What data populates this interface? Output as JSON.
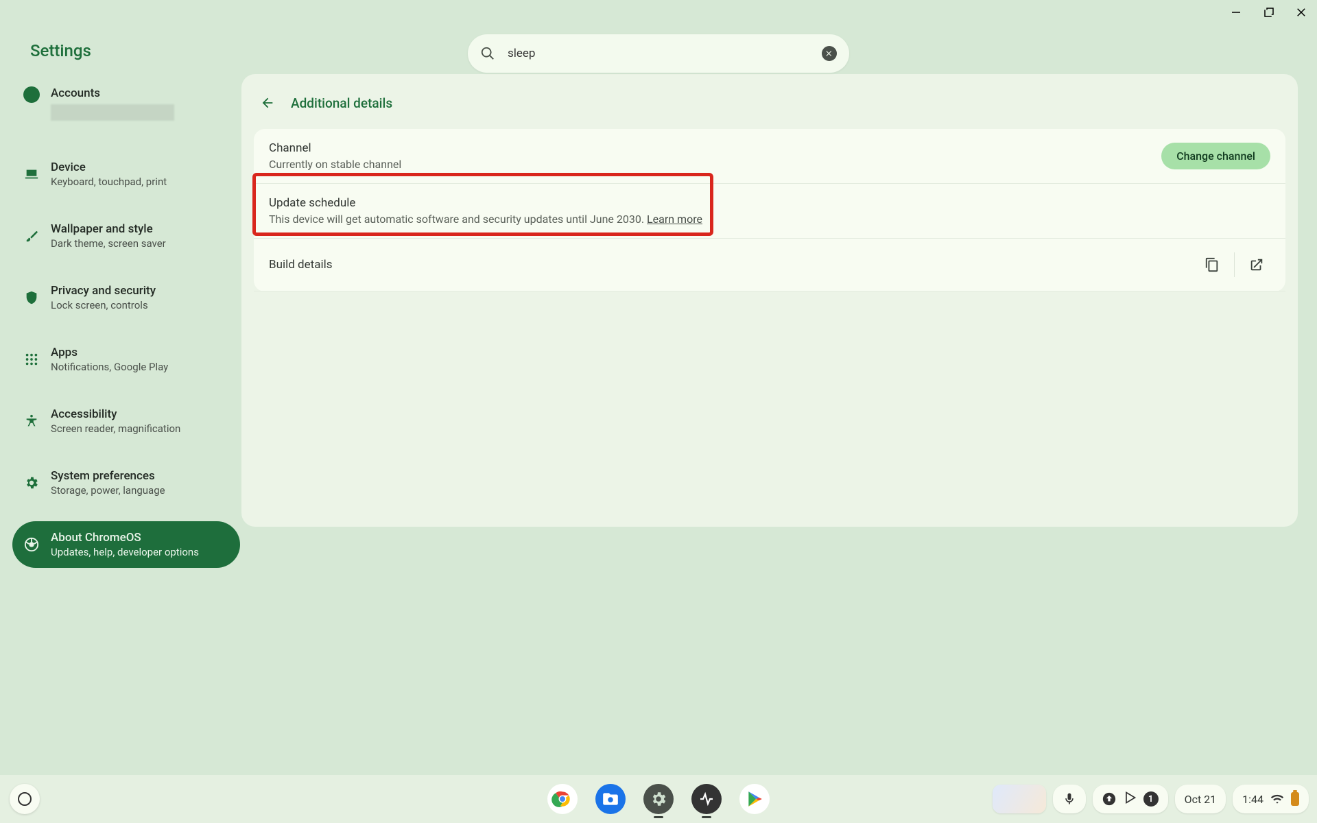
{
  "window": {
    "title": "Settings"
  },
  "search": {
    "value": "sleep"
  },
  "sidebar": {
    "accounts": {
      "title": "Accounts"
    },
    "items": [
      {
        "title": "Device",
        "subtitle": "Keyboard, touchpad, print"
      },
      {
        "title": "Wallpaper and style",
        "subtitle": "Dark theme, screen saver"
      },
      {
        "title": "Privacy and security",
        "subtitle": "Lock screen, controls"
      },
      {
        "title": "Apps",
        "subtitle": "Notifications, Google Play"
      },
      {
        "title": "Accessibility",
        "subtitle": "Screen reader, magnification"
      },
      {
        "title": "System preferences",
        "subtitle": "Storage, power, language"
      },
      {
        "title": "About ChromeOS",
        "subtitle": "Updates, help, developer options"
      }
    ]
  },
  "page": {
    "title": "Additional details",
    "channel": {
      "title": "Channel",
      "subtitle": "Currently on stable channel",
      "button": "Change channel"
    },
    "update": {
      "title": "Update schedule",
      "subtitle_prefix": "This device will get automatic software and security updates until June 2030. ",
      "learn_more": "Learn more"
    },
    "build": {
      "title": "Build details"
    }
  },
  "shelf": {
    "date": "Oct 21",
    "time": "1:44",
    "badge_count": "1"
  }
}
